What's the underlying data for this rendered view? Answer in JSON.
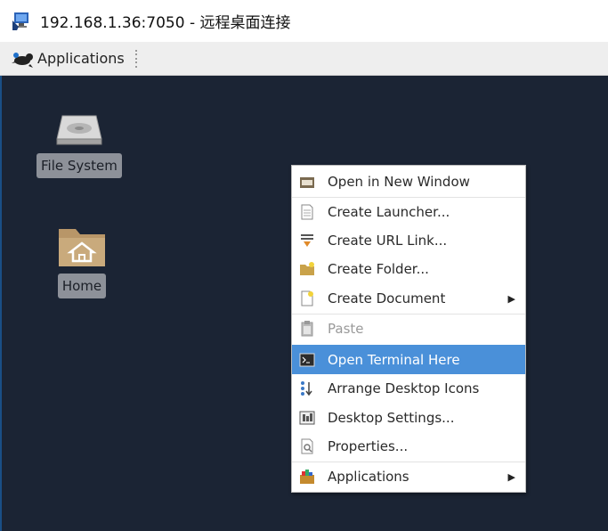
{
  "window": {
    "title": "192.168.1.36:7050 - 远程桌面连接"
  },
  "panel": {
    "applications_label": "Applications"
  },
  "desktop": {
    "icons": [
      {
        "label": "File System"
      },
      {
        "label": "Home"
      }
    ]
  },
  "context_menu": {
    "items": [
      {
        "label": "Open in New Window"
      },
      {
        "label": "Create Launcher..."
      },
      {
        "label": "Create URL Link..."
      },
      {
        "label": "Create Folder..."
      },
      {
        "label": "Create Document"
      },
      {
        "label": "Paste"
      },
      {
        "label": "Open Terminal Here"
      },
      {
        "label": "Arrange Desktop Icons"
      },
      {
        "label": "Desktop Settings..."
      },
      {
        "label": "Properties..."
      },
      {
        "label": "Applications"
      }
    ],
    "submenu_arrow": "▶"
  },
  "colors": {
    "desktop_bg": "#1b2434",
    "highlight": "#4a90d9",
    "label_bg": "#8d9199"
  }
}
